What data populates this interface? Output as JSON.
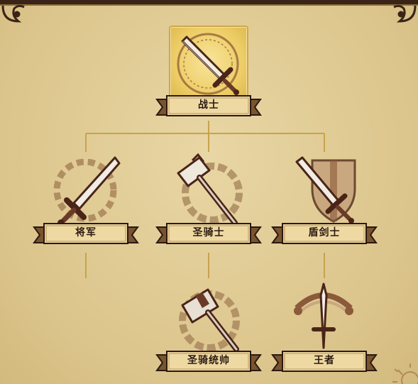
{
  "tree": {
    "nodes": [
      {
        "key": "warrior",
        "label": "战士",
        "icon": "sword-emblem-icon",
        "selected": true
      },
      {
        "key": "general",
        "label": "将军",
        "icon": "broadsword-wreath-icon",
        "selected": false
      },
      {
        "key": "paladin",
        "label": "圣骑士",
        "icon": "warhammer-icon",
        "selected": false
      },
      {
        "key": "shield-swordsman",
        "label": "盾剑士",
        "icon": "sword-shield-icon",
        "selected": false
      },
      {
        "key": "holy-marshal",
        "label": "圣骑统帅",
        "icon": "heavy-hammer-icon",
        "selected": false
      },
      {
        "key": "king",
        "label": "王者",
        "icon": "crowned-sword-icon",
        "selected": false
      }
    ]
  },
  "colors": {
    "background": "#dcc58c",
    "line": "#c9a24e",
    "icon": "#5a2e22",
    "selected_tile": "#edcd66",
    "banner": "#efd9a3"
  }
}
